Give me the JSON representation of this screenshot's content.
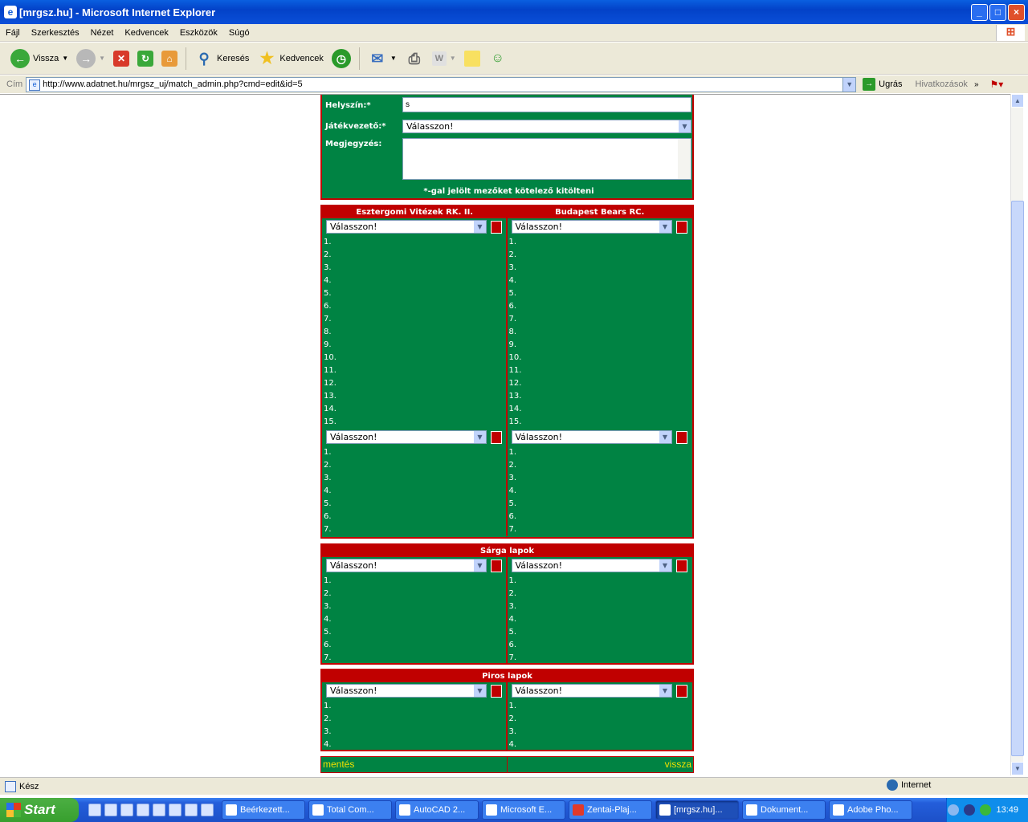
{
  "window": {
    "title": "[mrgsz.hu] - Microsoft Internet Explorer"
  },
  "menu": [
    "Fájl",
    "Szerkesztés",
    "Nézet",
    "Kedvencek",
    "Eszközök",
    "Súgó"
  ],
  "toolbar": {
    "back": "Vissza",
    "search": "Keresés",
    "favorites": "Kedvencek"
  },
  "address": {
    "label": "Cím",
    "url": "http://www.adatnet.hu/mrgsz_uj/match_admin.php?cmd=edit&id=5",
    "go": "Ugrás",
    "links": "Hivatkozások"
  },
  "form": {
    "location_label": "Helyszín:*",
    "location_value": "s",
    "referee_label": "Játékvezető:*",
    "referee_value": "Válasszon!",
    "note_label": "Megjegyzés:",
    "required_note": "*-gal jelölt mezőket kötelező kitölteni"
  },
  "teams": {
    "home": "Esztergomi Vitézek RK. II.",
    "away": "Budapest Bears RC."
  },
  "select_placeholder": "Válasszon!",
  "sections": {
    "yellow": "Sárga lapok",
    "red": "Piros lapok"
  },
  "rows": {
    "players": [
      "1.",
      "2.",
      "3.",
      "4.",
      "5.",
      "6.",
      "7.",
      "8.",
      "9.",
      "10.",
      "11.",
      "12.",
      "13.",
      "14.",
      "15."
    ],
    "subs": [
      "1.",
      "2.",
      "3.",
      "4.",
      "5.",
      "6.",
      "7."
    ],
    "yellow": [
      "1.",
      "2.",
      "3.",
      "4.",
      "5.",
      "6.",
      "7."
    ],
    "red": [
      "1.",
      "2.",
      "3.",
      "4."
    ]
  },
  "actions": {
    "save": "mentés",
    "back": "vissza"
  },
  "status": {
    "text": "Kész",
    "zone": "Internet"
  },
  "taskbar": {
    "start": "Start",
    "tasks": [
      "Beérkezett...",
      "Total Com...",
      "AutoCAD 2...",
      "Microsoft E...",
      "Zentai-Plaj...",
      "[mrgsz.hu]...",
      "Dokument...",
      "Adobe Pho..."
    ],
    "clock": "13:49"
  },
  "colors": {
    "green": "#008343",
    "red": "#c00000",
    "link_yellow": "#f0e000"
  }
}
